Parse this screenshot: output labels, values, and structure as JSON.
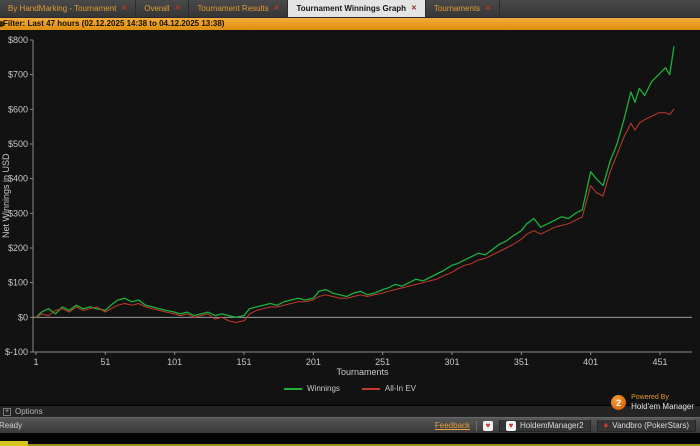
{
  "tabs": {
    "close_glyph": "✕",
    "items": [
      {
        "label": "By HandMarking - Tournament",
        "active": false
      },
      {
        "label": "Overall",
        "active": false
      },
      {
        "label": "Tournament Results",
        "active": false
      },
      {
        "label": "Tournament Winnings Graph",
        "active": true
      },
      {
        "label": "Tournaments",
        "active": false
      }
    ]
  },
  "filter_bar": {
    "text": "Filter:  Last 47 hours (02.12.2025 14:38 to 04.12.2025 13:38)"
  },
  "chart_data": {
    "type": "line",
    "title": "",
    "xlabel": "Tournaments",
    "ylabel": "Net Winnings in USD",
    "xlim": [
      1,
      474
    ],
    "ylim": [
      -100,
      800
    ],
    "grid": false,
    "legend_position": "bottom",
    "x_ticks": [
      1,
      51,
      101,
      151,
      201,
      251,
      301,
      351,
      401,
      451
    ],
    "y_ticks": [
      {
        "label": "$800",
        "value": 800
      },
      {
        "label": "$700",
        "value": 700
      },
      {
        "label": "$600",
        "value": 600
      },
      {
        "label": "$500",
        "value": 500
      },
      {
        "label": "$400",
        "value": 400
      },
      {
        "label": "$300",
        "value": 300
      },
      {
        "label": "$200",
        "value": 200
      },
      {
        "label": "$100",
        "value": 100
      },
      {
        "label": "$0",
        "value": 0
      },
      {
        "label": "$-100",
        "value": -100
      }
    ],
    "x": [
      1,
      5,
      10,
      15,
      20,
      25,
      30,
      35,
      40,
      45,
      51,
      55,
      60,
      65,
      70,
      75,
      80,
      85,
      90,
      95,
      101,
      105,
      110,
      115,
      120,
      125,
      130,
      135,
      140,
      145,
      151,
      155,
      160,
      165,
      170,
      175,
      180,
      185,
      190,
      195,
      201,
      205,
      210,
      215,
      220,
      225,
      230,
      235,
      240,
      245,
      251,
      255,
      260,
      265,
      270,
      275,
      280,
      285,
      290,
      295,
      301,
      305,
      310,
      315,
      320,
      325,
      330,
      335,
      340,
      345,
      351,
      355,
      360,
      365,
      370,
      375,
      380,
      385,
      390,
      395,
      401,
      405,
      410,
      415,
      420,
      425,
      430,
      433,
      436,
      440,
      445,
      450,
      455,
      458,
      461
    ],
    "series": [
      {
        "name": "Winnings",
        "color": "#1db13a",
        "values": [
          0,
          15,
          25,
          10,
          30,
          20,
          35,
          25,
          30,
          25,
          20,
          35,
          50,
          55,
          45,
          50,
          35,
          30,
          25,
          20,
          15,
          10,
          15,
          5,
          10,
          15,
          5,
          10,
          5,
          0,
          5,
          25,
          30,
          35,
          40,
          35,
          45,
          50,
          55,
          50,
          55,
          75,
          80,
          70,
          65,
          60,
          70,
          75,
          65,
          70,
          80,
          85,
          95,
          90,
          100,
          110,
          105,
          115,
          125,
          135,
          150,
          155,
          165,
          175,
          185,
          180,
          195,
          210,
          220,
          235,
          250,
          270,
          285,
          260,
          270,
          280,
          290,
          285,
          300,
          310,
          420,
          400,
          380,
          450,
          500,
          570,
          650,
          620,
          660,
          640,
          680,
          700,
          720,
          700,
          780
        ]
      },
      {
        "name": "All-In EV",
        "color": "#c23b2e",
        "values": [
          0,
          10,
          5,
          20,
          25,
          15,
          30,
          20,
          25,
          30,
          15,
          25,
          35,
          40,
          35,
          40,
          30,
          25,
          20,
          15,
          10,
          5,
          10,
          0,
          5,
          10,
          -5,
          0,
          -10,
          -15,
          -10,
          10,
          20,
          25,
          30,
          30,
          35,
          40,
          45,
          45,
          50,
          60,
          65,
          60,
          55,
          55,
          60,
          65,
          60,
          65,
          70,
          75,
          80,
          85,
          90,
          95,
          100,
          105,
          110,
          120,
          130,
          140,
          150,
          155,
          165,
          170,
          180,
          190,
          200,
          210,
          225,
          240,
          250,
          240,
          250,
          260,
          265,
          270,
          280,
          290,
          380,
          360,
          350,
          420,
          470,
          520,
          560,
          540,
          560,
          570,
          580,
          590,
          590,
          585,
          600
        ]
      }
    ]
  },
  "powered_by": {
    "line1": "Powered By",
    "line2": "Hold'em Manager",
    "badge": "2"
  },
  "options_bar": {
    "label": "Options",
    "icon_glyph": "+"
  },
  "status_bar": {
    "ready": "Ready",
    "feedback": "Feedback",
    "app_icon_glyph": "♥",
    "app_button": "HoldemManager2",
    "site_icon_glyph": "♦",
    "site_button": "Vandbro (PokerStars)"
  }
}
